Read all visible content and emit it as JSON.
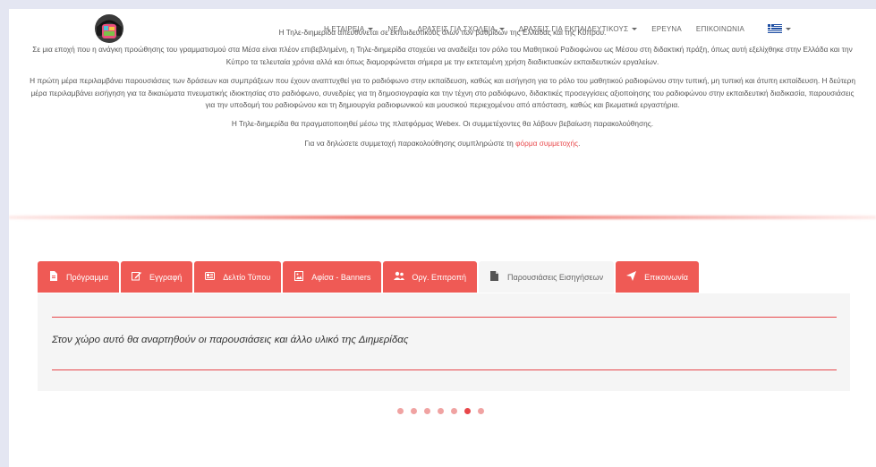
{
  "nav": {
    "items": [
      {
        "label": "Η ΕΤΑΙΡΕΙΑ",
        "dropdown": true
      },
      {
        "label": "ΝΕΑ",
        "dropdown": false
      },
      {
        "label": "ΔΡΑΣΕΙΣ ΓΙΑ ΣΧΟΛΕΙΑ",
        "dropdown": true
      },
      {
        "label": "ΔΡΑΣΕΙΣ ΓΙΑ ΕΚΠΑΙΔΕΥΤΙΚΟΥΣ",
        "dropdown": true
      },
      {
        "label": "ΕΡΕΥΝΑ",
        "dropdown": false
      },
      {
        "label": "ΕΠΙΚΟΙΝΩΝΙΑ",
        "dropdown": false
      }
    ],
    "language_flag": "greek-flag-icon"
  },
  "content": {
    "p1": "Η Τηλε-διημερίδα απευθύνεται σε εκπαιδευτικούς όλων των βαθμίδων της Ελλάδας και της Κύπρου.",
    "p2": "Σε μια εποχή που η ανάγκη προώθησης του γραμματισμού στα Μέσα είναι πλέον επιβεβλημένη, η Τηλε-διημερίδα στοχεύει να αναδείξει τον ρόλο του Μαθητικού Ραδιοφώνου ως Μέσου στη διδακτική πράξη, όπως αυτή εξελίχθηκε στην Ελλάδα και την Κύπρο τα τελευταία χρόνια αλλά και όπως διαμορφώνεται σήμερα με την εκτεταμένη χρήση διαδικτυακών εκπαιδευτικών εργαλείων.",
    "p3": "Η πρώτη μέρα περιλαμβάνει παρουσιάσεις των δράσεων και συμπράξεων που έχουν αναπτυχθεί για το ραδιόφωνο στην εκπαίδευση, καθώς και εισήγηση για το ρόλο του μαθητικού ραδιοφώνου στην τυπική, μη τυπική και άτυπη εκπαίδευση. Η δεύτερη μέρα περιλαμβάνει εισήγηση για τα δικαιώματα πνευματικής ιδιοκτησίας στο ραδιόφωνο, συνεδρίες για τη δημοσιογραφία και την τέχνη στο ραδιόφωνο, διδακτικές προσεγγίσεις αξιοποίησης του ραδιοφώνου στην εκπαιδευτική διαδικασία, παρουσιάσεις για την  υποδομή του ραδιοφώνου και τη δημιουργία ραδιοφωνικού και μουσικού περιεχομένου από απόσταση, καθώς και βιωματικά εργαστήρια.",
    "p4": "Η Τηλε-διημερίδα θα πραγματοποιηθεί μέσω της πλατφόρμας Webex. Οι συμμετέχοντες θα λάβουν βεβαίωση παρακολούθησης.",
    "p5_prefix": "Για να δηλώσετε συμμετοχή παρακολούθησης συμπληρώστε τη ",
    "p5_link": "φόρμα συμμετοχής",
    "p5_suffix": "."
  },
  "tabs": [
    {
      "label": "Πρόγραμμα",
      "icon": "document-icon",
      "active": false
    },
    {
      "label": "Εγγραφή",
      "icon": "edit-icon",
      "active": false
    },
    {
      "label": "Δελτίο Τύπου",
      "icon": "newspaper-icon",
      "active": false
    },
    {
      "label": "Αφίσα - Banners",
      "icon": "image-file-icon",
      "active": false
    },
    {
      "label": "Οργ. Επιτροπή",
      "icon": "users-icon",
      "active": false
    },
    {
      "label": "Παρουσιάσεις Εισηγήσεων",
      "icon": "file-icon",
      "active": true
    },
    {
      "label": "Επικοινωνία",
      "icon": "send-icon",
      "active": false
    }
  ],
  "panel": {
    "message": "Στον χώρο αυτό θα αναρτηθούν οι παρουσιάσεις και άλλο υλικό της Διημερίδας"
  },
  "pager": {
    "total": 7,
    "active_index": 5
  },
  "colors": {
    "accent": "#ef5a55",
    "accent_dark": "#e8474a",
    "dot_inactive": "#f0a3a2",
    "panel_bg": "#f5f5f5"
  }
}
